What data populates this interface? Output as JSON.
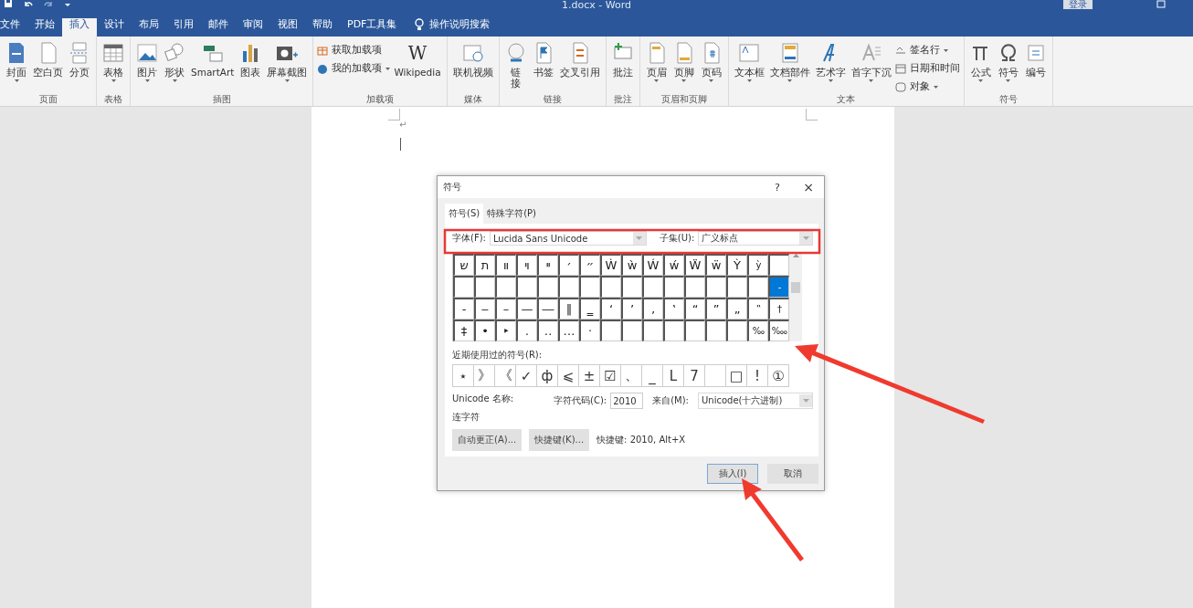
{
  "window": {
    "title": "1.docx  -  Word",
    "login": "登录"
  },
  "tabs": [
    {
      "label": "文件",
      "selected": false
    },
    {
      "label": "开始",
      "selected": false
    },
    {
      "label": "插入",
      "selected": true
    },
    {
      "label": "设计",
      "selected": false
    },
    {
      "label": "布局",
      "selected": false
    },
    {
      "label": "引用",
      "selected": false
    },
    {
      "label": "邮件",
      "selected": false
    },
    {
      "label": "审阅",
      "selected": false
    },
    {
      "label": "视图",
      "selected": false
    },
    {
      "label": "帮助",
      "selected": false
    },
    {
      "label": "PDF工具集",
      "selected": false
    }
  ],
  "search": {
    "label": "操作说明搜索"
  },
  "ribbon": {
    "groups": [
      {
        "label": "页面",
        "items": [
          {
            "kind": "large",
            "label": "封面",
            "dropdown": true
          },
          {
            "kind": "large",
            "label": "空白页",
            "dropdown": false
          },
          {
            "kind": "large",
            "label": "分页",
            "dropdown": false
          }
        ]
      },
      {
        "label": "表格",
        "items": [
          {
            "kind": "large",
            "label": "表格",
            "dropdown": true
          }
        ]
      },
      {
        "label": "插图",
        "items": [
          {
            "kind": "large",
            "label": "图片",
            "dropdown": true
          },
          {
            "kind": "large",
            "label": "形状",
            "dropdown": true
          },
          {
            "kind": "large",
            "label": "SmartArt",
            "dropdown": false
          },
          {
            "kind": "large",
            "label": "图表",
            "dropdown": false
          },
          {
            "kind": "large",
            "label": "屏幕截图",
            "dropdown": true
          }
        ]
      },
      {
        "label": "加载项",
        "items": [
          {
            "kind": "stack",
            "entries": [
              {
                "label": "获取加载项",
                "dropdown": false
              },
              {
                "label": "我的加载项",
                "dropdown": true
              }
            ]
          },
          {
            "kind": "logo",
            "logo": "W",
            "label": "Wikipedia",
            "dropdown": false
          }
        ]
      },
      {
        "label": "媒体",
        "items": [
          {
            "kind": "large",
            "label": "联机视频",
            "dropdown": false
          }
        ]
      },
      {
        "label": "链接",
        "items": [
          {
            "kind": "narrow",
            "label": "链接",
            "dropdown": false
          },
          {
            "kind": "large",
            "label": "书签",
            "dropdown": false
          },
          {
            "kind": "large",
            "label": "交叉引用",
            "dropdown": false
          }
        ]
      },
      {
        "label": "批注",
        "items": [
          {
            "kind": "large",
            "label": "批注",
            "dropdown": false
          }
        ]
      },
      {
        "label": "页眉和页脚",
        "items": [
          {
            "kind": "large",
            "label": "页眉",
            "dropdown": true
          },
          {
            "kind": "large",
            "label": "页脚",
            "dropdown": true
          },
          {
            "kind": "large",
            "label": "页码",
            "dropdown": true
          }
        ]
      },
      {
        "label": "文本",
        "items": [
          {
            "kind": "large",
            "label": "文本框",
            "dropdown": true
          },
          {
            "kind": "large",
            "label": "文档部件",
            "dropdown": true
          },
          {
            "kind": "large",
            "label": "艺术字",
            "dropdown": true
          },
          {
            "kind": "large",
            "label": "首字下沉",
            "dropdown": true
          },
          {
            "kind": "stack",
            "entries": [
              {
                "label": "签名行",
                "dropdown": true
              },
              {
                "label": "日期和时间",
                "dropdown": false
              },
              {
                "label": "对象",
                "dropdown": true
              }
            ]
          }
        ]
      },
      {
        "label": "符号",
        "items": [
          {
            "kind": "large",
            "label": "公式",
            "dropdown": true
          },
          {
            "kind": "large",
            "label": "符号",
            "dropdown": true
          },
          {
            "kind": "large",
            "label": "编号",
            "dropdown": false
          }
        ]
      }
    ]
  },
  "document": {
    "paragraph_mark": "↵"
  },
  "dialog": {
    "title": "符号",
    "help": "?",
    "close": "×",
    "tabs": [
      {
        "label": "符号(S)",
        "selected": true
      },
      {
        "label": "特殊字符(P)",
        "selected": false
      }
    ],
    "font": {
      "label": "字体(F):",
      "value": "Lucida Sans Unicode"
    },
    "subset": {
      "label": "子集(U):",
      "value": "广义标点"
    },
    "grid": [
      [
        {
          "c": "ש",
          "selected": false
        },
        {
          "c": "ת",
          "selected": false
        },
        {
          "c": "װ",
          "selected": false
        },
        {
          "c": "ױ",
          "selected": false
        },
        {
          "c": "ײ",
          "selected": false
        },
        {
          "c": "׳",
          "selected": false
        },
        {
          "c": "״",
          "selected": false
        },
        {
          "c": "Ẁ",
          "selected": false
        },
        {
          "c": "ẁ",
          "selected": false
        },
        {
          "c": "Ẃ",
          "selected": false
        },
        {
          "c": "ẃ",
          "selected": false
        },
        {
          "c": "Ẅ",
          "selected": false
        },
        {
          "c": "ẅ",
          "selected": false
        },
        {
          "c": "Ỳ",
          "selected": false
        },
        {
          "c": "ỳ",
          "selected": false
        },
        {
          "selected": false
        }
      ],
      [
        {
          "selected": false
        },
        {
          "selected": false
        },
        {
          "selected": false
        },
        {
          "selected": false
        },
        {
          "selected": false
        },
        {
          "selected": false
        },
        {
          "selected": false
        },
        {
          "selected": false
        },
        {
          "selected": false
        },
        {
          "selected": false
        },
        {
          "selected": false
        },
        {
          "selected": false
        },
        {
          "selected": false
        },
        {
          "selected": false
        },
        {
          "selected": false
        },
        {
          "c": "‐",
          "selected": true
        }
      ],
      [
        {
          "c": "‑",
          "selected": false
        },
        {
          "c": "‒",
          "selected": false
        },
        {
          "c": "–",
          "selected": false
        },
        {
          "c": "—",
          "selected": false
        },
        {
          "c": "―",
          "selected": false
        },
        {
          "c": "‖",
          "selected": false
        },
        {
          "c": "‗",
          "selected": false
        },
        {
          "c": "‘",
          "selected": false
        },
        {
          "c": "’",
          "selected": false
        },
        {
          "c": "‚",
          "selected": false
        },
        {
          "c": "‛",
          "selected": false
        },
        {
          "c": "“",
          "selected": false
        },
        {
          "c": "”",
          "selected": false
        },
        {
          "c": "„",
          "selected": false
        },
        {
          "c": "‟",
          "selected": false
        },
        {
          "c": "†",
          "selected": false
        }
      ],
      [
        {
          "c": "‡",
          "selected": false
        },
        {
          "c": "•",
          "selected": false
        },
        {
          "c": "‣",
          "selected": false
        },
        {
          "c": "․",
          "selected": false
        },
        {
          "c": "‥",
          "selected": false
        },
        {
          "c": "…",
          "selected": false
        },
        {
          "c": "‧",
          "selected": false
        },
        {
          "selected": false
        },
        {
          "selected": false
        },
        {
          "selected": false
        },
        {
          "selected": false
        },
        {
          "selected": false
        },
        {
          "selected": false
        },
        {
          "selected": false
        },
        {
          "c": "‰",
          "selected": false
        },
        {
          "c": "‱",
          "selected": false
        }
      ]
    ],
    "recent_label": "近期使用过的符号(R):",
    "recent": [
      {
        "c": "⋆"
      },
      {
        "c": "》"
      },
      {
        "c": "《"
      },
      {
        "c": "✓"
      },
      {
        "c": "ф"
      },
      {
        "c": "⩽"
      },
      {
        "c": "±"
      },
      {
        "c": "☑"
      },
      {
        "c": "、"
      },
      {
        "c": "_"
      },
      {
        "c": "L"
      },
      {
        "c": "7"
      },
      {
        "blank": true
      },
      {
        "c": "□"
      },
      {
        "c": "!"
      },
      {
        "c": "①"
      }
    ],
    "unicode_name_label": "Unicode 名称:",
    "unicode_name": "连字符",
    "char_code": {
      "label": "字符代码(C):",
      "value": "2010"
    },
    "from": {
      "label": "来自(M):",
      "value": "Unicode(十六进制)"
    },
    "autocorrect": "自动更正(A)...",
    "shortcut_key": "快捷键(K)...",
    "shortcut_text": "快捷键: 2010, Alt+X",
    "insert": "插入(I)",
    "cancel": "取消"
  }
}
